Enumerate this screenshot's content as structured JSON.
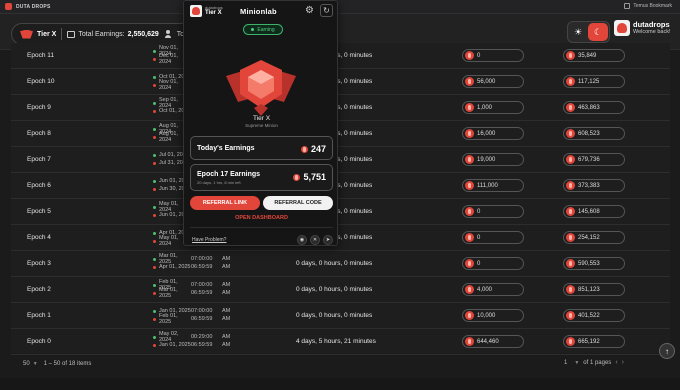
{
  "browser": {
    "tab_title": "DUTA DROPS",
    "bookmark_label": "Temus Bookmark"
  },
  "header": {
    "tier": "Tier X",
    "total_earnings_label": "Total Earnings:",
    "total_earnings_value": "2,550,629",
    "total_referrals_label": "Total Ref",
    "username": "dutadrops",
    "welcome": "Welcome back!"
  },
  "colors": {
    "accent": "#e2463a",
    "earning_green": "#4bd082",
    "background": "#1b1b1b"
  },
  "icons": {
    "theme_light": "sun-icon",
    "theme_dark": "moon-icon",
    "settings": "gear-icon",
    "refresh": "refresh-icon"
  },
  "rows": [
    {
      "epoch": "Epoch 11",
      "start_date": "Nov 01, 2024",
      "start_time": "",
      "start_ampm": "",
      "end_date": "Dec 01, 2024",
      "end_time": "",
      "end_ampm": "",
      "duration": "0 days, 0 hours, 0 minutes",
      "earnings": "0",
      "total": "35,849"
    },
    {
      "epoch": "Epoch 10",
      "start_date": "Oct 01, 2024",
      "start_time": "",
      "start_ampm": "",
      "end_date": "Nov 01, 2024",
      "end_time": "",
      "end_ampm": "",
      "duration": "0 days, 0 hours, 0 minutes",
      "earnings": "56,000",
      "total": "117,125"
    },
    {
      "epoch": "Epoch 9",
      "start_date": "Sep 01, 2024",
      "start_time": "",
      "start_ampm": "",
      "end_date": "Oct 01, 2024",
      "end_time": "",
      "end_ampm": "",
      "duration": "0 days, 0 hours, 0 minutes",
      "earnings": "1,000",
      "total": "463,863"
    },
    {
      "epoch": "Epoch 8",
      "start_date": "Aug 01, 2024",
      "start_time": "",
      "start_ampm": "",
      "end_date": "Aug 01, 2024",
      "end_time": "",
      "end_ampm": "",
      "duration": "0 days, 0 hours, 0 minutes",
      "earnings": "16,000",
      "total": "608,523"
    },
    {
      "epoch": "Epoch 7",
      "start_date": "Jul 01, 2024",
      "start_time": "",
      "start_ampm": "",
      "end_date": "Jul 31, 2024",
      "end_time": "",
      "end_ampm": "",
      "duration": "0 days, 0 hours, 0 minutes",
      "earnings": "19,000",
      "total": "679,736"
    },
    {
      "epoch": "Epoch 6",
      "start_date": "Jun 01, 2024",
      "start_time": "",
      "start_ampm": "",
      "end_date": "Jun 30, 2024",
      "end_time": "",
      "end_ampm": "",
      "duration": "0 days, 0 hours, 0 minutes",
      "earnings": "111,000",
      "total": "373,383"
    },
    {
      "epoch": "Epoch 5",
      "start_date": "May 01, 2024",
      "start_time": "",
      "start_ampm": "",
      "end_date": "Jun 01, 2024",
      "end_time": "",
      "end_ampm": "",
      "duration": "0 days, 0 hours, 0 minutes",
      "earnings": "0",
      "total": "145,608"
    },
    {
      "epoch": "Epoch 4",
      "start_date": "Apr 01, 2024",
      "start_time": "",
      "start_ampm": "",
      "end_date": "May 01, 2024",
      "end_time": "",
      "end_ampm": "",
      "duration": "0 days, 0 hours, 0 minutes",
      "earnings": "0",
      "total": "254,152"
    },
    {
      "epoch": "Epoch 3",
      "start_date": "Mar 01, 2025",
      "start_time": "07:00:00",
      "start_ampm": "AM",
      "end_date": "Apr 01, 2025",
      "end_time": "06:59:59",
      "end_ampm": "AM",
      "duration": "0 days, 0 hours, 0 minutes",
      "earnings": "0",
      "total": "590,553"
    },
    {
      "epoch": "Epoch 2",
      "start_date": "Feb 01, 2025",
      "start_time": "07:00:00",
      "start_ampm": "AM",
      "end_date": "Mar 01, 2025",
      "end_time": "06:59:59",
      "end_ampm": "AM",
      "duration": "0 days, 0 hours, 0 minutes",
      "earnings": "4,000",
      "total": "851,123"
    },
    {
      "epoch": "Epoch 1",
      "start_date": "Jan 01, 2025",
      "start_time": "07:00:00",
      "start_ampm": "AM",
      "end_date": "Feb 01, 2025",
      "end_time": "06:59:59",
      "end_ampm": "AM",
      "duration": "0 days, 0 hours, 0 minutes",
      "earnings": "10,000",
      "total": "401,522"
    },
    {
      "epoch": "Epoch 0",
      "start_date": "May 02, 2024",
      "start_time": "00:29:00",
      "start_ampm": "AM",
      "end_date": "Jan 01, 2025",
      "end_time": "06:59:59",
      "end_ampm": "AM",
      "duration": "4 days, 5 hours, 21 minutes",
      "earnings": "644,460",
      "total": "665,192"
    }
  ],
  "footer": {
    "per_page": "50",
    "range": "1 – 50 of 18 items",
    "page": "1",
    "of_pages": "of 1 pages"
  },
  "popup": {
    "username": "dutadrops",
    "tier": "Tier X",
    "brand": "Minionlab",
    "status": "Earning",
    "tier_name": "Tier X",
    "tier_sub": "Supreme Minion",
    "today_label": "Today's Earnings",
    "today_value": "247",
    "epoch_label": "Epoch 17 Earnings",
    "epoch_sub": "20 days, 1 hrs, 8 min left",
    "epoch_value": "5,751",
    "referral_link": "REFERRAL LINK",
    "referral_code": "REFERRAL CODE",
    "open_dashboard": "OPEN DASHBOARD",
    "have_problem": "Have Problem?"
  }
}
